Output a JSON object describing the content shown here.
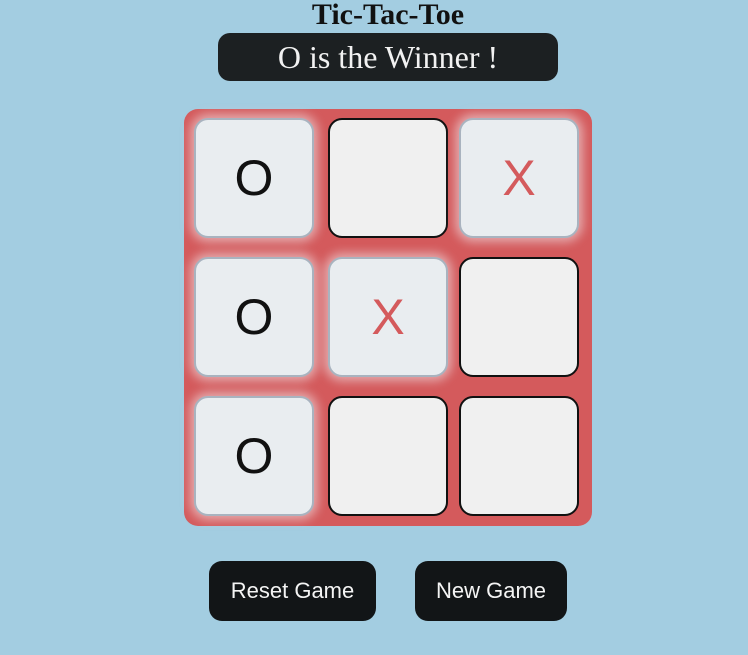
{
  "title": "Tic-Tac-Toe",
  "status": "O is the Winner !",
  "board": {
    "cells": [
      {
        "row": 0,
        "col": 0,
        "mark": "O"
      },
      {
        "row": 0,
        "col": 1,
        "mark": ""
      },
      {
        "row": 0,
        "col": 2,
        "mark": "X"
      },
      {
        "row": 1,
        "col": 0,
        "mark": "O"
      },
      {
        "row": 1,
        "col": 1,
        "mark": "X"
      },
      {
        "row": 1,
        "col": 2,
        "mark": ""
      },
      {
        "row": 2,
        "col": 0,
        "mark": "O"
      },
      {
        "row": 2,
        "col": 1,
        "mark": ""
      },
      {
        "row": 2,
        "col": 2,
        "mark": ""
      }
    ]
  },
  "buttons": {
    "reset_label": "Reset Game",
    "new_label": "New Game"
  },
  "colors": {
    "background": "#a3cde1",
    "board": "#d45a5c",
    "x_mark": "#d45a5c",
    "o_mark": "#111111",
    "status_bg": "#1c2022",
    "button_bg": "#121517"
  }
}
